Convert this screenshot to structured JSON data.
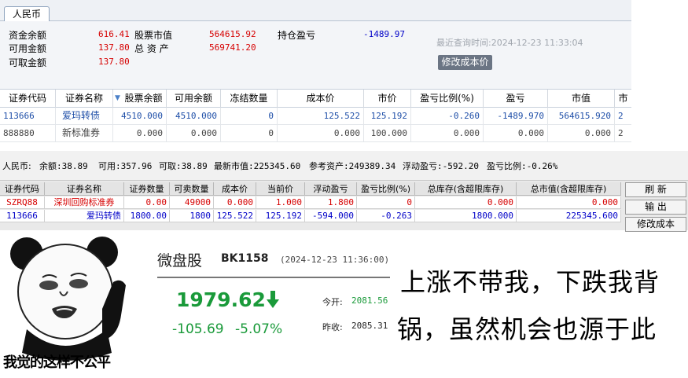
{
  "top": {
    "tab": "人民币",
    "summary": {
      "cash_label": "资金余额",
      "cash": "616.41",
      "available_label": "可用金额",
      "available": "137.80",
      "withdrawable_label": "可取金额",
      "withdrawable": "137.80",
      "mkt_value_label": "股票市值",
      "mkt_value": "564615.92",
      "total_assets_label": "总 资 产",
      "total_assets": "569741.20",
      "pnl_label": "持仓盈亏",
      "pnl": "-1489.97",
      "last_query": "最近查询时间:2024-12-23  11:33:04",
      "modify_cost_label": "修改成本价"
    },
    "holdings": {
      "headers": [
        "证券代码",
        "证券名称",
        "股票余额",
        "可用余额",
        "冻结数量",
        "成本价",
        "市价",
        "盈亏比例(%)",
        "盈亏",
        "市值",
        "市"
      ],
      "rows": [
        [
          "113666",
          "爱玛转债",
          "4510.000",
          "4510.000",
          "0",
          "125.522",
          "125.192",
          "-0.260",
          "-1489.970",
          "564615.920",
          "2"
        ],
        [
          "888880",
          "新标准券",
          "0.000",
          "0.000",
          "0",
          "0.000",
          "100.000",
          "0.000",
          "0.000",
          "0.000",
          "2"
        ]
      ]
    }
  },
  "mid": {
    "info": {
      "currency": "人民币:",
      "balance": "余额:38.89",
      "available": "可用:357.96",
      "withdrawable": "可取:38.89",
      "latest_mkt": "最新市值:225345.60",
      "ref_assets": "参考资产:249389.34",
      "float_pnl": "浮动盈亏:-592.20",
      "pnl_ratio": "盈亏比例:-0.26%"
    },
    "headers": [
      "证券代码",
      "证券名称",
      "证券数量",
      "可卖数量",
      "成本价",
      "当前价",
      "浮动盈亏",
      "盈亏比例(%)",
      "总库存(含超限库存)",
      "总市值(含超限库存)"
    ],
    "rows": [
      [
        "SZRQ88",
        "深圳回购标准券",
        "0.00",
        "49000",
        "0.000",
        "1.000",
        "1.800",
        "0",
        "0.000",
        "0.000"
      ],
      [
        "113666",
        "爱玛转债",
        "1800.00",
        "1800",
        "125.522",
        "125.192",
        "-594.000",
        "-0.263",
        "1800.000",
        "225345.600"
      ]
    ],
    "buttons": [
      "刷 新",
      "输 出",
      "修改成本"
    ]
  },
  "bottom": {
    "meme_caption": "我觉的这样不公平",
    "quote": {
      "title": "微盘股",
      "code": "BK1158",
      "time": "(2024-12-23 11:36:00)",
      "price": "1979.62",
      "change": "-105.69",
      "change_pct": "-5.07%",
      "open_label": "今开:",
      "open": "2081.56",
      "prev_close_label": "昨收:",
      "prev_close": "2085.31"
    },
    "slogan_line1": "上涨不带我，下跌我背",
    "slogan_line2": "锅，虽然机会也源于此"
  },
  "colors": {
    "up_red": "#d60000",
    "down_green": "#1a9a3a",
    "link_blue": "#1f4fa8"
  }
}
